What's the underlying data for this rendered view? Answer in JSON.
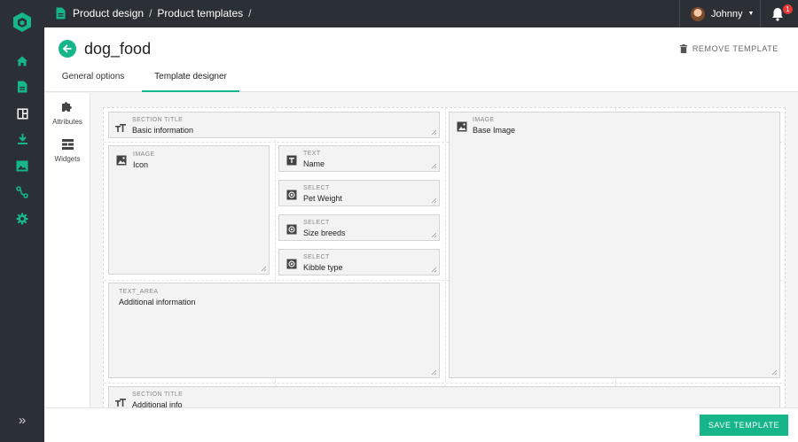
{
  "nav": {
    "logo_icon": "cube-logo-icon",
    "items": [
      {
        "icon": "home-icon"
      },
      {
        "icon": "document-icon"
      },
      {
        "icon": "dashboard-icon"
      },
      {
        "icon": "download-icon"
      },
      {
        "icon": "image-icon"
      },
      {
        "icon": "route-icon"
      },
      {
        "icon": "gear-icon"
      }
    ],
    "expand_label": "»",
    "accent_color": "#16b58a"
  },
  "breadcrumb": {
    "icon": "document-icon",
    "items": [
      "Product design",
      "Product templates"
    ],
    "separator": "/"
  },
  "user": {
    "name": "Johnny",
    "notifications": "1"
  },
  "header": {
    "title": "dog_food",
    "remove_label": "REMOVE TEMPLATE",
    "tabs": [
      "General options",
      "Template designer"
    ],
    "active_tab": "Template designer"
  },
  "sidepanel": {
    "items": [
      {
        "label": "Attributes",
        "icon": "puzzle-icon"
      },
      {
        "label": "Widgets",
        "icon": "widgets-icon"
      }
    ]
  },
  "fields": {
    "section1": {
      "type": "SECTION TITLE",
      "name": "Basic information"
    },
    "icon_image": {
      "type": "IMAGE",
      "name": "Icon"
    },
    "name_text": {
      "type": "TEXT",
      "name": "Name"
    },
    "pet_weight": {
      "type": "SELECT",
      "name": "Pet Weight"
    },
    "size_breeds": {
      "type": "SELECT",
      "name": "Size breeds"
    },
    "kibble_type": {
      "type": "SELECT",
      "name": "Kibble type"
    },
    "additional_text": {
      "type": "TEXT_AREA",
      "name": "Additional information"
    },
    "base_image": {
      "type": "IMAGE",
      "name": "Base Image"
    },
    "section2": {
      "type": "SECTION TITLE",
      "name": "Additional info"
    }
  },
  "footer": {
    "save_label": "SAVE TEMPLATE"
  }
}
